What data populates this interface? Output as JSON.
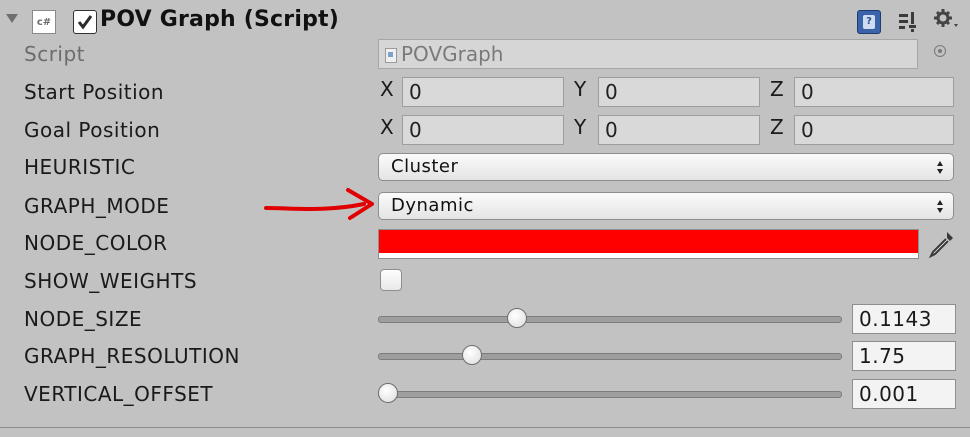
{
  "component": {
    "title": "POV Graph (Script)",
    "type_icon": "cs-script-icon",
    "type_icon_text": "c#",
    "enabled": true,
    "header_icons": [
      "help-icon",
      "preset-icon",
      "gear-icon"
    ]
  },
  "script_row": {
    "label": "Script",
    "value": "POVGraph"
  },
  "vectors": [
    {
      "label": "Start Position",
      "x_label": "X",
      "x": "0",
      "y_label": "Y",
      "y": "0",
      "z_label": "Z",
      "z": "0"
    },
    {
      "label": "Goal Position",
      "x_label": "X",
      "x": "0",
      "y_label": "Y",
      "y": "0",
      "z_label": "Z",
      "z": "0"
    }
  ],
  "heuristic": {
    "label": "HEURISTIC",
    "value": "Cluster"
  },
  "graph_mode": {
    "label": "GRAPH_MODE",
    "value": "Dynamic"
  },
  "node_color": {
    "label": "NODE_COLOR",
    "color": "#ff0000"
  },
  "show_weights": {
    "label": "SHOW_WEIGHTS",
    "checked": false
  },
  "sliders": [
    {
      "label": "NODE_SIZE",
      "value": "0.1143",
      "fraction": 0.29
    },
    {
      "label": "GRAPH_RESOLUTION",
      "value": "1.75",
      "fraction": 0.19
    },
    {
      "label": "VERTICAL_OFFSET",
      "value": "0.001",
      "fraction": 0.0
    }
  ],
  "annotation": {
    "arrow_color": "#e00000"
  }
}
